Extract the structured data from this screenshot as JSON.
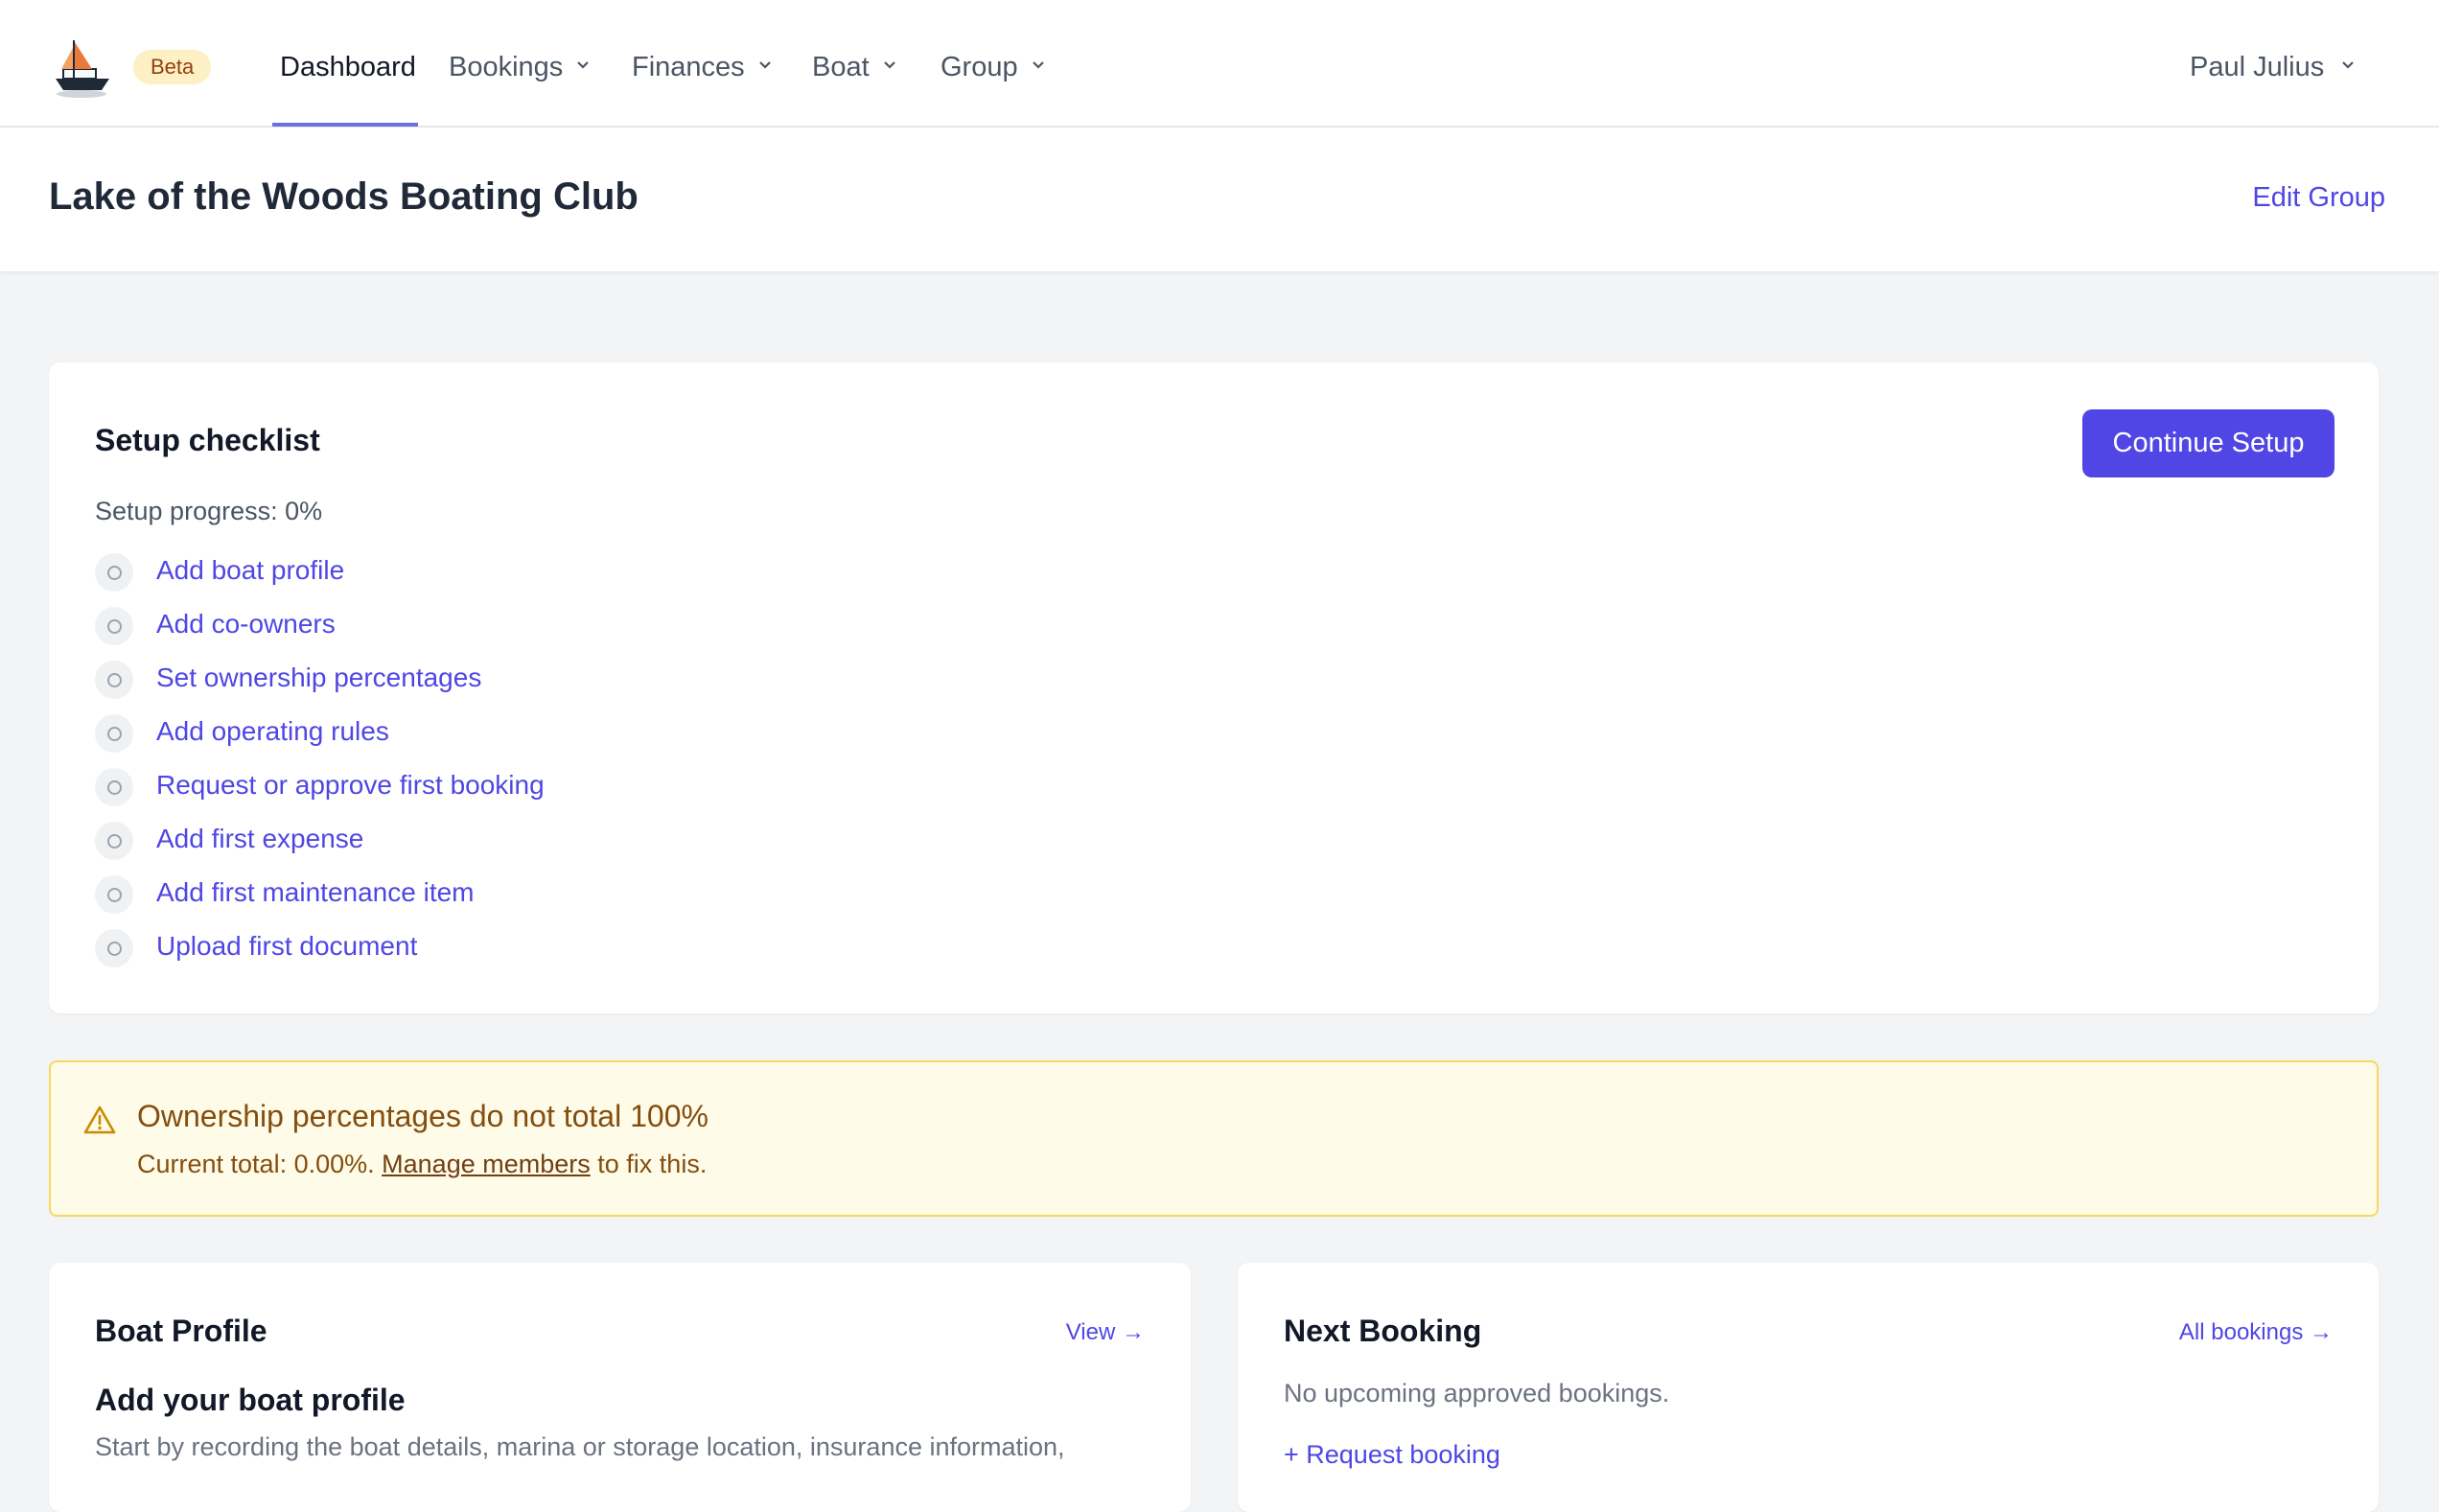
{
  "nav": {
    "beta": "Beta",
    "items": [
      {
        "label": "Dashboard"
      },
      {
        "label": "Bookings"
      },
      {
        "label": "Finances"
      },
      {
        "label": "Boat"
      },
      {
        "label": "Group"
      }
    ],
    "active": "Dashboard",
    "user": "Paul Julius",
    "accent": "#6d6fdf"
  },
  "header": {
    "title": "Lake of the Woods Boating Club",
    "edit_link": "Edit Group"
  },
  "checklist": {
    "title": "Setup checklist",
    "continue_button": "Continue Setup",
    "progress_text": "Setup progress: 0%",
    "progress": 0,
    "items": [
      {
        "label": "Add boat profile"
      },
      {
        "label": "Add co-owners"
      },
      {
        "label": "Set ownership percentages"
      },
      {
        "label": "Add operating rules"
      },
      {
        "label": "Request or approve first booking"
      },
      {
        "label": "Add first expense"
      },
      {
        "label": "Add first maintenance item"
      },
      {
        "label": "Upload first document"
      }
    ]
  },
  "alert": {
    "title": "Ownership percentages do not total 100%",
    "body_prefix": "Current total: 0.00%.",
    "link": "Manage members",
    "body_suffix": "to fix this.",
    "icon": "warning-icon"
  },
  "boat_profile": {
    "title": "Boat Profile",
    "link": "View →",
    "subheading": "Add your boat profile",
    "description": "Start by recording the boat details, marina or storage location, insurance information,"
  },
  "next_booking": {
    "title": "Next Booking",
    "link": "All bookings →",
    "empty_text": "No upcoming approved bookings.",
    "action": "+ Request booking"
  },
  "colors": {
    "primary": "#4f46e5",
    "warning_bg": "#fefce8",
    "warning_border": "#f6d860",
    "warning_text": "#854d0e"
  }
}
